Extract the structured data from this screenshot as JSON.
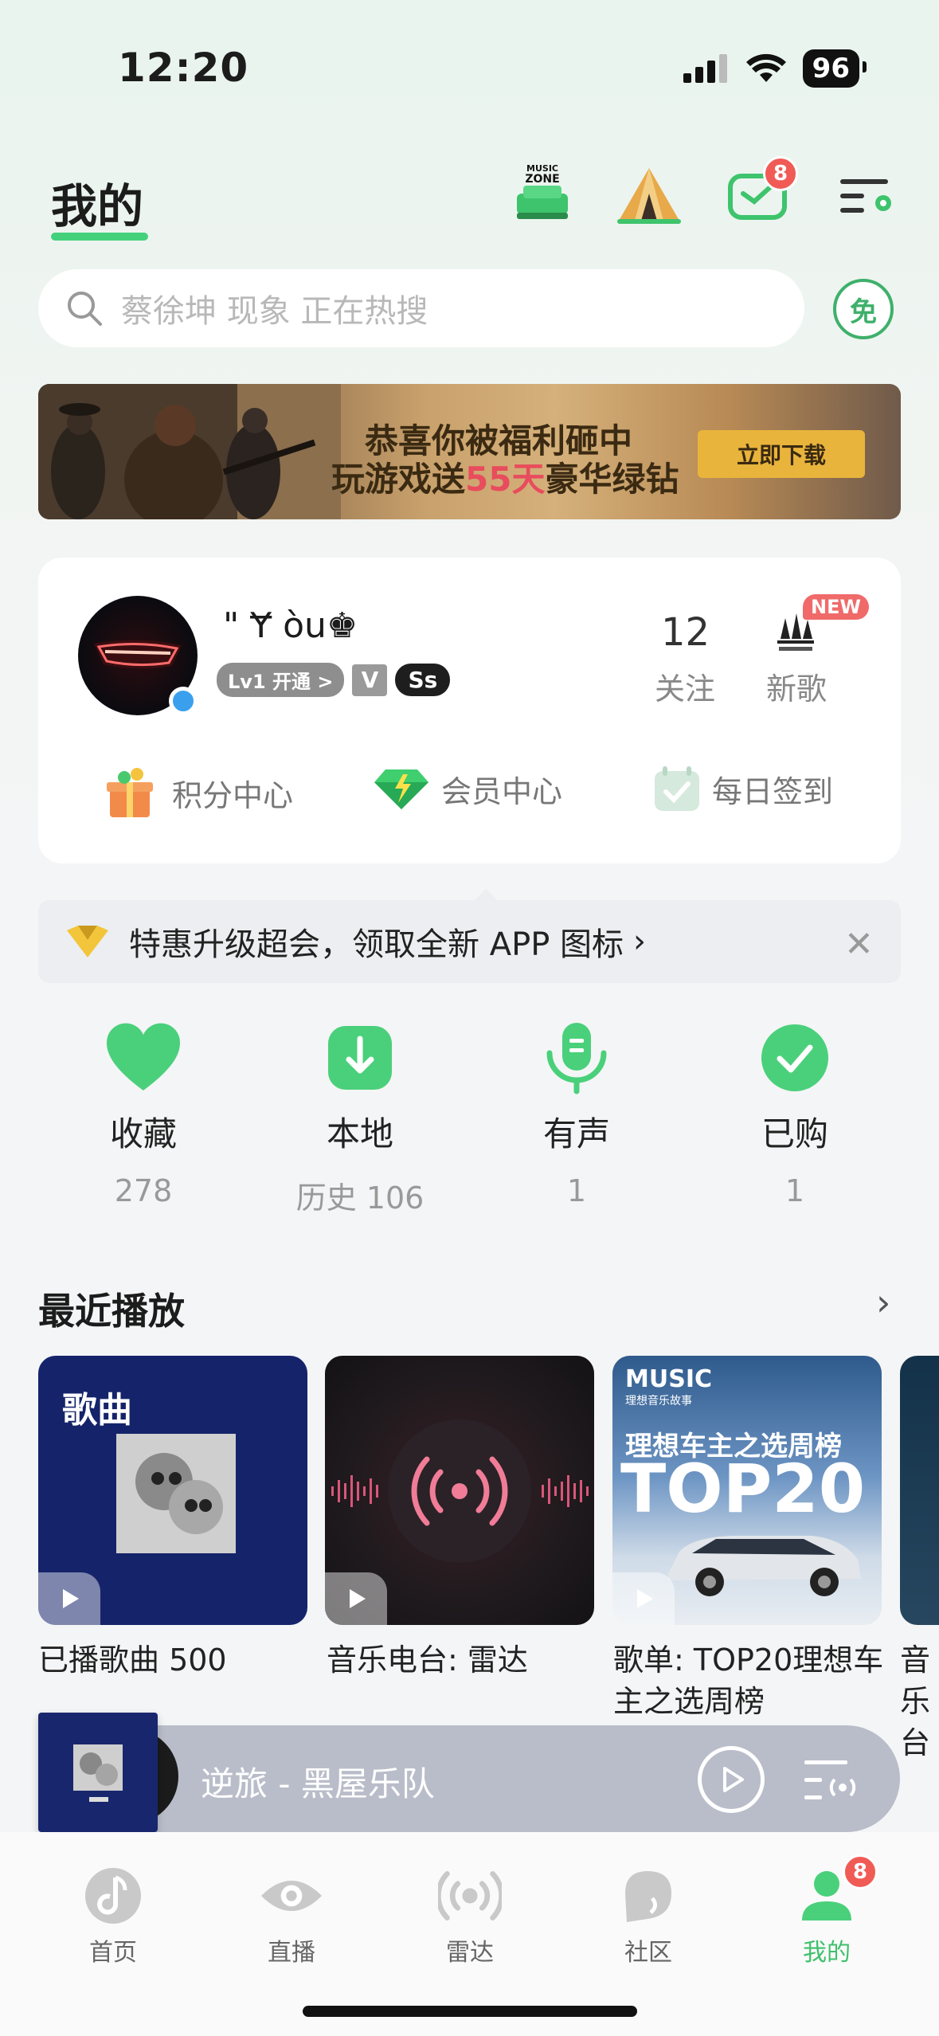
{
  "status_bar": {
    "time": "12:20",
    "battery": "96"
  },
  "header": {
    "tab_mine": "我的",
    "mail_badge": "8"
  },
  "search": {
    "hint": "蔡徐坤 现象  正在热搜",
    "free_label": "免"
  },
  "banner": {
    "line1": "恭喜你被福利砸中",
    "line2_a": "玩游戏送",
    "line2_b": "55天",
    "line2_c": "豪华绿钻",
    "cta": "立即下载"
  },
  "profile": {
    "username": "\" Ɏ òu♚",
    "level_badge": "Lv1 开通 >",
    "vip_badge": "V",
    "ss_badge": "Ss",
    "following_count": "12",
    "following_label": "关注",
    "new_songs_label": "新歌",
    "new_badge": "NEW",
    "points_center": "积分中心",
    "member_center": "会员中心",
    "daily_checkin": "每日签到"
  },
  "upgrade": {
    "text": "特惠升级超会，领取全新 APP 图标"
  },
  "stats": [
    {
      "label": "收藏",
      "value": "278"
    },
    {
      "label": "本地",
      "value": "历史 106"
    },
    {
      "label": "有声",
      "value": "1"
    },
    {
      "label": "已购",
      "value": "1"
    }
  ],
  "recent": {
    "title": "最近播放",
    "tiles": [
      {
        "overlay": "歌曲",
        "caption": "已播歌曲 500"
      },
      {
        "caption": "音乐电台: 雷达"
      },
      {
        "caption": "歌单: TOP20理想车主之选周榜",
        "logo": "MUSIC",
        "logo_sub": "理想音乐故事",
        "heading": "理想车主之选周榜",
        "big": "TOP20"
      },
      {
        "caption": "音乐台"
      }
    ]
  },
  "player": {
    "track": "逆旅 - 黑屋乐队"
  },
  "nav": {
    "items": [
      {
        "label": "首页"
      },
      {
        "label": "直播"
      },
      {
        "label": "雷达"
      },
      {
        "label": "社区"
      },
      {
        "label": "我的"
      }
    ],
    "mine_badge": "8"
  },
  "colors": {
    "accent": "#45d17c",
    "badge": "#f05b55",
    "player_bg": "#b9bdc9"
  }
}
